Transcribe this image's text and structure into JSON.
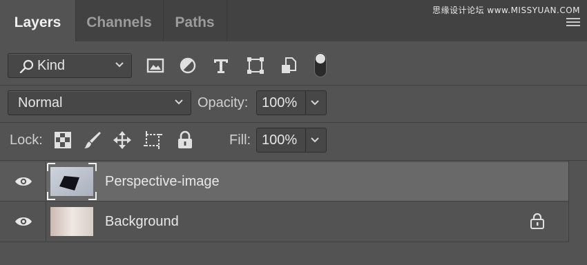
{
  "tabs": [
    {
      "label": "Layers",
      "active": true
    },
    {
      "label": "Channels",
      "active": false
    },
    {
      "label": "Paths",
      "active": false
    }
  ],
  "watermark": "思缘设计论坛 www.MISSYUAN.COM",
  "filter": {
    "kind_label": "Kind",
    "icons": [
      "image-filter-icon",
      "adjustment-filter-icon",
      "type-filter-icon",
      "shape-filter-icon",
      "smart-object-filter-icon"
    ]
  },
  "blend": {
    "mode": "Normal",
    "opacity_label": "Opacity:",
    "opacity_value": "100%"
  },
  "lock": {
    "label": "Lock:",
    "icons": [
      "lock-transparent-pixels-icon",
      "lock-image-pixels-icon",
      "lock-position-icon",
      "prevent-auto-nesting-icon",
      "lock-all-icon"
    ],
    "fill_label": "Fill:",
    "fill_value": "100%"
  },
  "layers": [
    {
      "name": "Perspective-image",
      "selected": true,
      "locked": false
    },
    {
      "name": "Background",
      "selected": false,
      "locked": true
    }
  ],
  "colors": {
    "panel": "#535353",
    "tabbar": "#424242",
    "selected_layer": "#696969",
    "layer_row": "#4f4f4f"
  }
}
